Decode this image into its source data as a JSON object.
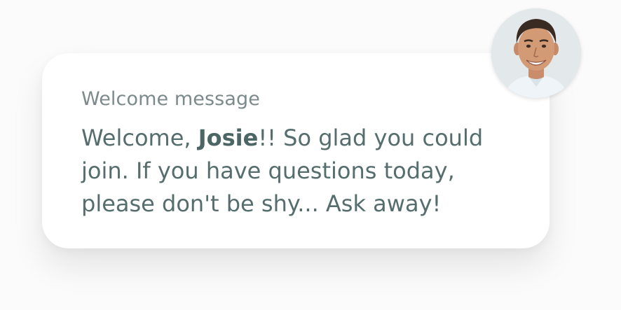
{
  "welcome_card": {
    "label": "Welcome message",
    "message_prefix": "Welcome, ",
    "user_name": "Josie",
    "message_suffix": "!! So glad you could join. If you have questions today, please don't be shy... Ask away!"
  },
  "colors": {
    "label_text": "#7c8a8b",
    "message_text": "#556e6d",
    "card_background": "#ffffff"
  },
  "avatar": {
    "icon": "host-photo"
  }
}
